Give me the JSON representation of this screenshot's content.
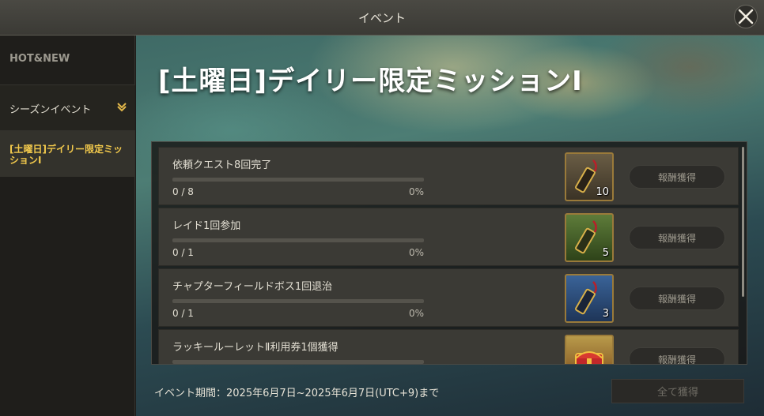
{
  "window": {
    "title": "イベント"
  },
  "sidebar": {
    "items": [
      {
        "label": "HOT&NEW"
      },
      {
        "label": "シーズンイベント"
      },
      {
        "label": "[土曜日]デイリー限定ミッションⅠ"
      }
    ]
  },
  "banner": {
    "title": "[土曜日]デイリー限定ミッションⅠ"
  },
  "missions": [
    {
      "name": "依頼クエスト8回完了",
      "progress": "0 / 8",
      "percent": "0%",
      "fraction": 0,
      "reward_icon": "brown-scroll-token-icon",
      "reward_qty": "10",
      "claim_label": "報酬獲得"
    },
    {
      "name": "レイド1回参加",
      "progress": "0 / 1",
      "percent": "0%",
      "fraction": 0,
      "reward_icon": "green-scroll-token-icon",
      "reward_qty": "5",
      "claim_label": "報酬獲得"
    },
    {
      "name": "チャプターフィールドボス1回退治",
      "progress": "0 / 1",
      "percent": "0%",
      "fraction": 0,
      "reward_icon": "blue-scroll-token-icon",
      "reward_qty": "3",
      "claim_label": "報酬獲得"
    },
    {
      "name": "ラッキールーレットⅡ利用券1個獲得",
      "reward_icon": "treasure-chest-icon",
      "claim_label": "報酬獲得"
    }
  ],
  "footer": {
    "period": "イベント期間：2025年6月7日~2025年6月7日(UTC+9)まで",
    "claim_all_label": "全て獲得"
  },
  "colors": {
    "accent": "#f2c94c",
    "panel": "#3b3a35",
    "background": "#1f1e1b"
  }
}
